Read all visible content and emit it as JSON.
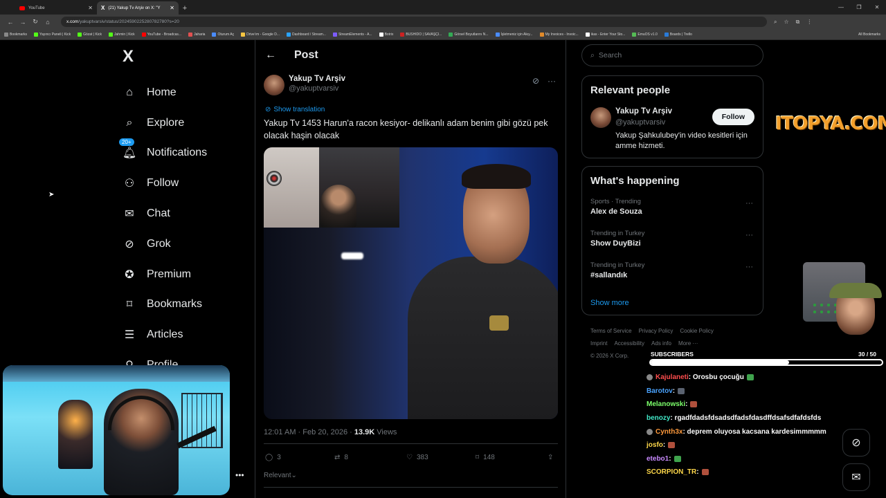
{
  "browser": {
    "tabs": [
      {
        "title": "YouTube"
      },
      {
        "title": "(21) Yakup Tv Arşiv on X: \"Y"
      }
    ],
    "new_tab": "+",
    "url_host": "x.com",
    "url_path": "/yakuptvarsiv/status/2024590225280782780?s=20",
    "bookmarks": [
      {
        "label": "Bookmarks",
        "color": "#888888"
      },
      {
        "label": "Yayıncı Paneli | Kick",
        "color": "#53fc18"
      },
      {
        "label": "Gözat | Kick",
        "color": "#53fc18"
      },
      {
        "label": "Jahmin | Kick",
        "color": "#53fc18"
      },
      {
        "label": "YouTube - Broadcas...",
        "color": "#ff0000"
      },
      {
        "label": "Jaharia",
        "color": "#e05050"
      },
      {
        "label": "Oturum Aç",
        "color": "#4a8cff"
      },
      {
        "label": "Drive'ım - Google D...",
        "color": "#f5c542"
      },
      {
        "label": "Dashboard / Stream...",
        "color": "#2aa3ff"
      },
      {
        "label": "StreamElements - A...",
        "color": "#7d5cff"
      },
      {
        "label": "Botrix",
        "color": "#ffffff"
      },
      {
        "label": "BUSHIDO | SAVAŞÇI...",
        "color": "#cc2222"
      },
      {
        "label": "Görsel Boyutlarını N...",
        "color": "#33aa55"
      },
      {
        "label": "İşletmeniz için Akıy...",
        "color": "#4a8cff"
      },
      {
        "label": "My Invoices - Invoic...",
        "color": "#e08a2a"
      },
      {
        "label": "ikas - Enter Your Sto...",
        "color": "#ffffff"
      },
      {
        "label": "EmuOS v1.0",
        "color": "#55bb55"
      },
      {
        "label": "Boards | Trello",
        "color": "#2a7bd8"
      }
    ],
    "all_bookmarks": "All Bookmarks"
  },
  "sidebar": {
    "logo": "X",
    "items": [
      {
        "label": "Home",
        "icon": "home-icon"
      },
      {
        "label": "Explore",
        "icon": "search-icon"
      },
      {
        "label": "Notifications",
        "icon": "bell-icon"
      },
      {
        "label": "Follow",
        "icon": "add-user-icon"
      },
      {
        "label": "Chat",
        "icon": "mail-icon"
      },
      {
        "label": "Grok",
        "icon": "grok-icon"
      },
      {
        "label": "Premium",
        "icon": "verified-icon"
      },
      {
        "label": "Bookmarks",
        "icon": "bookmark-icon"
      },
      {
        "label": "Articles",
        "icon": "article-icon"
      },
      {
        "label": "Profile",
        "icon": "profile-icon"
      }
    ],
    "notification_badge": "20+",
    "more": "•••"
  },
  "post": {
    "header": "Post",
    "author_name": "Yakup Tv Arşiv",
    "author_handle": "@yakuptvarsiv",
    "show_translation": "Show translation",
    "text": "Yakup Tv 1453 Harun'a racon kesiyor-  delikanlı adam benim gibi gözü pek olacak haşin olacak",
    "time": "12:01 AM · Feb 20, 2026 · ",
    "views_count": "13.9K",
    "views_label": " Views",
    "replies": "3",
    "reposts": "8",
    "likes": "383",
    "bookmarks": "148",
    "relevant": "Relevant"
  },
  "right": {
    "search_placeholder": "Search",
    "relevant_title": "Relevant people",
    "rp_name": "Yakup Tv Arşiv",
    "rp_handle": "@yakuptvarsiv",
    "rp_bio": "Yakup Şahkulubey'in video kesitleri için amme hizmeti.",
    "follow": "Follow",
    "happening_title": "What's happening",
    "trends": [
      {
        "context": "Sports · Trending",
        "name": "Alex de Souza"
      },
      {
        "context": "Trending in Turkey",
        "name": "Show DuyBizi"
      },
      {
        "context": "Trending in Turkey",
        "name": "#sallandık"
      }
    ],
    "show_more": "Show more",
    "footer": [
      "Terms of Service",
      "Privacy Policy",
      "Cookie Policy",
      "Imprint",
      "Accessibility",
      "Ads info",
      "More ···",
      "© 2026 X Corp."
    ]
  },
  "stream": {
    "sponsor": "ITOPYA.COM",
    "subscribers_label": "SUBSCRIBERS",
    "subscribers_count": "30  / 50",
    "subscribers_progress": 0.6,
    "chat": [
      {
        "user": "Kajulaneti",
        "color": "#ff4d4d",
        "msg": ": Orosbu çocuğu",
        "badge": true,
        "emote": "#3fa34d"
      },
      {
        "user": "Barotov",
        "color": "#4aa3ff",
        "msg": ": ",
        "badge": false,
        "emote": "#5a6270"
      },
      {
        "user": "Melanowski",
        "color": "#7cff6b",
        "msg": ": ",
        "badge": false,
        "emote": "#b0503c"
      },
      {
        "user": "benozy",
        "color": "#42e8c8",
        "msg": ": rgadfdadsfdsadsdfadsfdasdffdsafsdfafdsfds",
        "badge": false,
        "emote": ""
      },
      {
        "user": "Cynth3x",
        "color": "#ff9a3c",
        "msg": ": deprem oluyosa kacsana kardesimmmmm",
        "badge": true,
        "emote": ""
      },
      {
        "user": "josfo",
        "color": "#ffd84a",
        "msg": ": ",
        "badge": false,
        "emote": "#b0503c"
      },
      {
        "user": "etebo1",
        "color": "#c98aff",
        "msg": ": ",
        "badge": false,
        "emote": "#3fa34d"
      },
      {
        "user": "SCORPION_TR",
        "color": "#ffd84a",
        "msg": ": ",
        "badge": false,
        "emote": "#b0503c"
      }
    ]
  }
}
